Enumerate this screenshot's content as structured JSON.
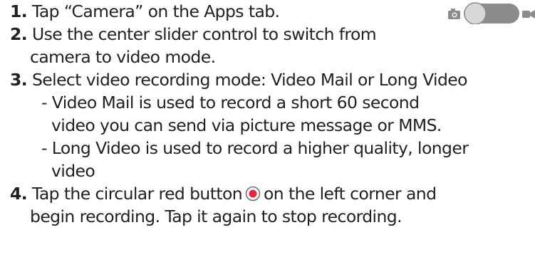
{
  "steps": [
    {
      "number": "1.",
      "lines": [
        "Tap “Camera” on the Apps tab."
      ]
    },
    {
      "number": "2.",
      "lines": [
        "Use the center slider control to switch from",
        "camera to video mode."
      ]
    },
    {
      "number": "3.",
      "lines": [
        "Select video recording mode: Video Mail or Long Video"
      ],
      "subitems": [
        {
          "lines": [
            "- Video Mail is used to record a short 60 second",
            "video you can send via picture message or MMS."
          ]
        },
        {
          "lines": [
            "- Long Video is used to record a higher quality, longer",
            "video"
          ]
        }
      ]
    },
    {
      "number": "4.",
      "before_icon": "Tap the circular red button",
      "after_icon": "on the left corner and",
      "lines": [
        "begin recording. Tap it again to stop recording."
      ]
    }
  ],
  "icons": {
    "camera": "camera-icon",
    "video": "video-camera-icon",
    "slider": "mode-slider",
    "record": "record-button-icon"
  },
  "colors": {
    "text": "#231f20",
    "record_red": "#e0283a",
    "slider_gray": "#8a8c8e",
    "slider_light": "#d6d7d8"
  }
}
